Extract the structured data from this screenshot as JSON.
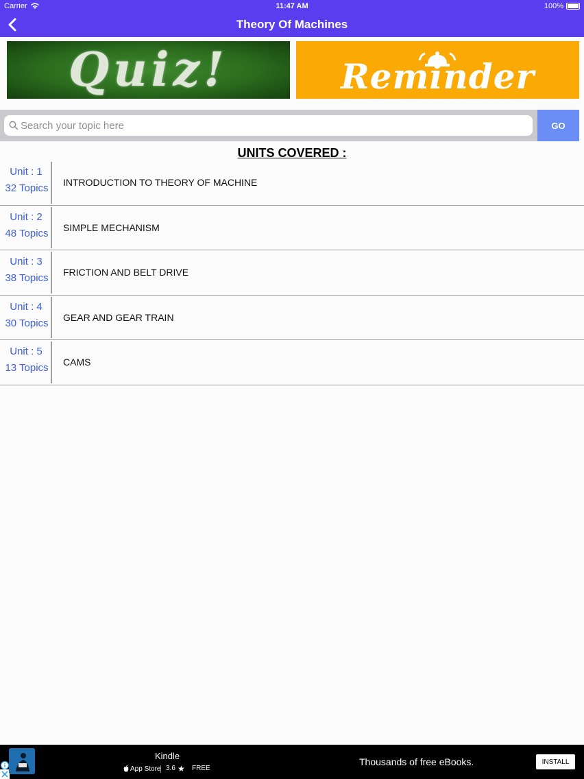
{
  "status_bar": {
    "carrier": "Carrier",
    "time": "11:47 AM",
    "battery": "100%"
  },
  "nav": {
    "title": "Theory Of Machines"
  },
  "banners": {
    "quiz_text": "Quiz!",
    "reminder_text": "Reminder"
  },
  "search": {
    "placeholder": "Search your topic here",
    "value": "",
    "go_label": "GO"
  },
  "section_title": "UNITS COVERED :",
  "units": [
    {
      "unit": "Unit : 1",
      "topics": "32 Topics",
      "name": "INTRODUCTION TO THEORY OF MACHINE"
    },
    {
      "unit": "Unit : 2",
      "topics": "48 Topics",
      "name": "SIMPLE MECHANISM"
    },
    {
      "unit": "Unit : 3",
      "topics": "38 Topics",
      "name": "FRICTION AND BELT DRIVE"
    },
    {
      "unit": "Unit : 4",
      "topics": "30 Topics",
      "name": "GEAR AND GEAR TRAIN"
    },
    {
      "unit": "Unit : 5",
      "topics": "13 Topics",
      "name": "CAMS"
    }
  ],
  "ad": {
    "title": "Kindle",
    "store": "App Store",
    "rating": "3.6",
    "price": "FREE",
    "tagline": "Thousands of free eBooks.",
    "install_label": "INSTALL"
  },
  "colors": {
    "header": "#5b3df0",
    "go_button": "#6a8ef5",
    "unit_text": "#3e5fd6",
    "reminder_bg": "#fbaa05"
  }
}
